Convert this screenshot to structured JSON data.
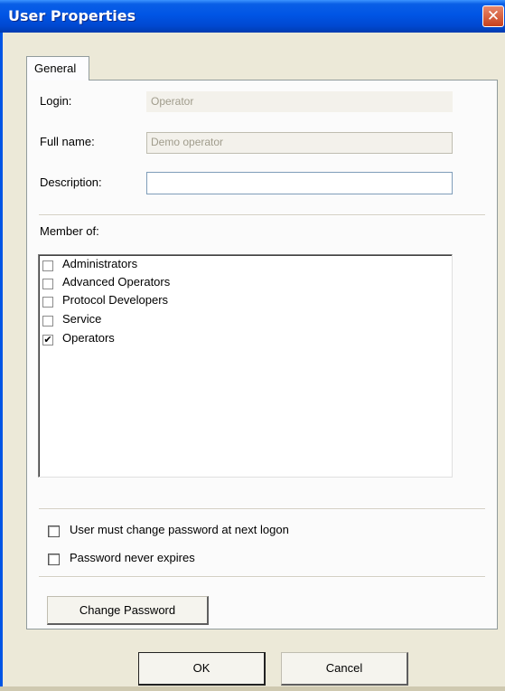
{
  "window": {
    "title": "User Properties",
    "close_glyph": "✕",
    "close_icon": "close-icon"
  },
  "tabs": [
    {
      "label": "General",
      "active": true
    }
  ],
  "general": {
    "login_label": "Login:",
    "login_value": "Operator",
    "fullname_label": "Full name:",
    "fullname_value": "Demo operator",
    "description_label": "Description:",
    "description_value": "",
    "member_of_label": "Member of:",
    "groups": [
      {
        "label": "Administrators",
        "checked": false
      },
      {
        "label": "Advanced Operators",
        "checked": false
      },
      {
        "label": "Protocol Developers",
        "checked": false
      },
      {
        "label": "Service",
        "checked": false
      },
      {
        "label": "Operators",
        "checked": true
      }
    ],
    "must_change_password_label": "User must change password at next logon",
    "must_change_password_checked": false,
    "never_expires_label": "Password never expires",
    "never_expires_checked": false,
    "change_password_label": "Change Password"
  },
  "buttons": {
    "ok_label": "OK",
    "cancel_label": "Cancel"
  },
  "colors": {
    "titlebar": "#0055e5",
    "dialog_bg": "#ece9d8",
    "field_border": "#7f9db9"
  }
}
